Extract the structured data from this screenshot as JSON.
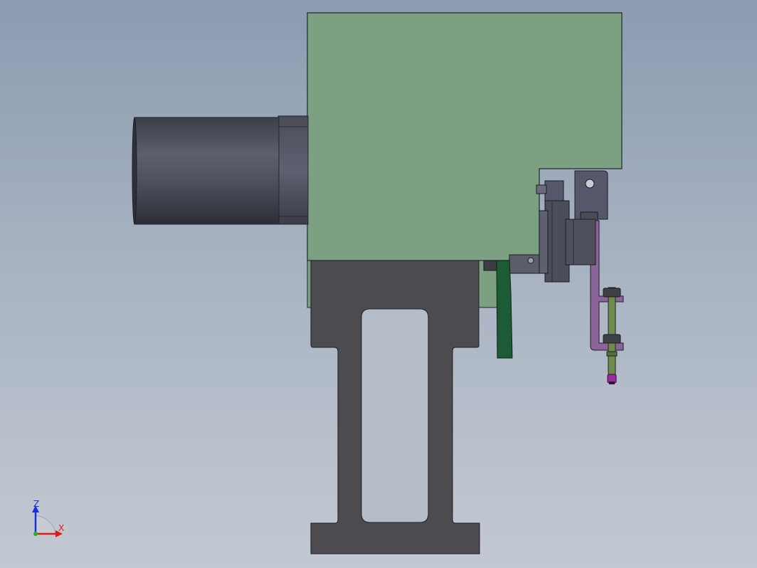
{
  "viewport": {
    "type": "cad-3d-view",
    "view_orientation": "front"
  },
  "triad": {
    "z_label": "Z",
    "x_label": "X",
    "z_color": "#1a2ee0",
    "x_color": "#e01a1a"
  },
  "colors": {
    "housing_green": "#7ca082",
    "motor_dark": "#4f525e",
    "base_dark": "#4b4b50",
    "bracket_purple": "#8a6698",
    "rod_green": "#6e8a4e",
    "tip_magenta": "#9a2aa0",
    "cable_green": "#1d5a36"
  }
}
